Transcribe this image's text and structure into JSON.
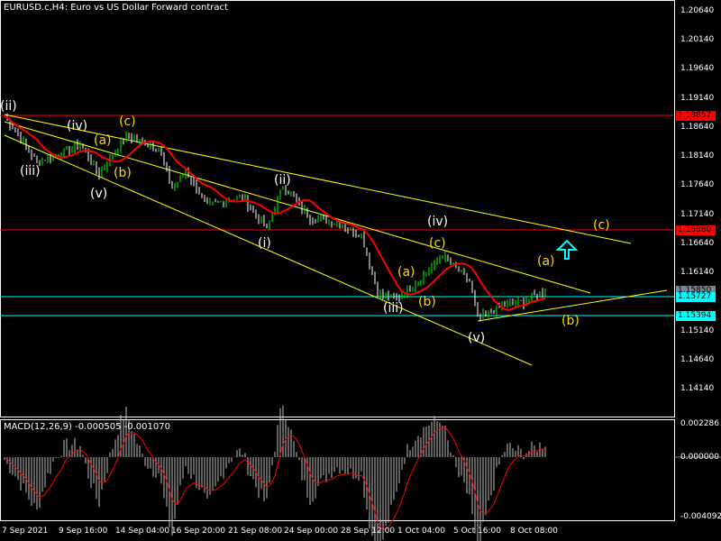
{
  "header": {
    "title": "EURUSD.c,H4:  Euro vs US Dollar Forward contract"
  },
  "macd": {
    "label": "MACD(12,26,9) -0.000505 -0.001070",
    "axis": [
      "0.002286",
      "0.000000",
      "-0.004092"
    ]
  },
  "price_axis": [
    "1.20640",
    "1.20140",
    "1.19640",
    "1.19140",
    "1.18640",
    "1.18140",
    "1.17640",
    "1.17140",
    "1.16640",
    "1.16140",
    "1.15140",
    "1.14640",
    "1.14140"
  ],
  "price_tags": {
    "red1": "1.18857",
    "red2": "1.16880",
    "current": "1.15850",
    "cyan1": "1.15727",
    "cyan2": "1.15394"
  },
  "time_axis": [
    "7 Sep 2021",
    "9 Sep 16:00",
    "14 Sep 04:00",
    "16 Sep 20:00",
    "21 Sep 08:00",
    "24 Sep 00:00",
    "28 Sep 12:00",
    "1 Oct 04:00",
    "5 Oct 16:00",
    "8 Oct 08:00"
  ],
  "waves": {
    "ii_a": "(ii)",
    "iii_a": "(iii)",
    "iv_a": "(iv)",
    "v_a": "(v)",
    "a1": "(a)",
    "b1": "(b)",
    "c1": "(c)",
    "ii_b": "(ii)",
    "i_b": "(i)",
    "iv_b": "(iv)",
    "c2": "(c)",
    "a2": "(a)",
    "b2": "(b)",
    "iii_b": "(iii)",
    "v_b": "(v)",
    "a3": "(a)",
    "b3": "(b)",
    "c3": "(c)"
  },
  "colors": {
    "bull": "#00ff00",
    "red": "#ff0000",
    "cyan": "#00ffff",
    "yellow": "#ffff00",
    "wave": "#ffd700"
  },
  "chart_data": {
    "type": "candlestick",
    "symbol": "EURUSD.c",
    "timeframe": "H4",
    "ylim": [
      1.1382,
      1.209
    ],
    "keypoints": [
      [
        0,
        1.1885
      ],
      [
        12,
        1.1805
      ],
      [
        28,
        1.1835
      ],
      [
        35,
        1.1785
      ],
      [
        45,
        1.185
      ],
      [
        57,
        1.183
      ],
      [
        62,
        1.176
      ],
      [
        67,
        1.179
      ],
      [
        75,
        1.173
      ],
      [
        88,
        1.1745
      ],
      [
        97,
        1.169
      ],
      [
        103,
        1.1765
      ],
      [
        113,
        1.171
      ],
      [
        123,
        1.17
      ],
      [
        132,
        1.168
      ],
      [
        138,
        1.158
      ],
      [
        145,
        1.157
      ],
      [
        155,
        1.161
      ],
      [
        162,
        1.1645
      ],
      [
        172,
        1.16
      ],
      [
        175,
        1.1535
      ],
      [
        185,
        1.156
      ],
      [
        192,
        1.1565
      ],
      [
        200,
        1.1585
      ]
    ]
  }
}
